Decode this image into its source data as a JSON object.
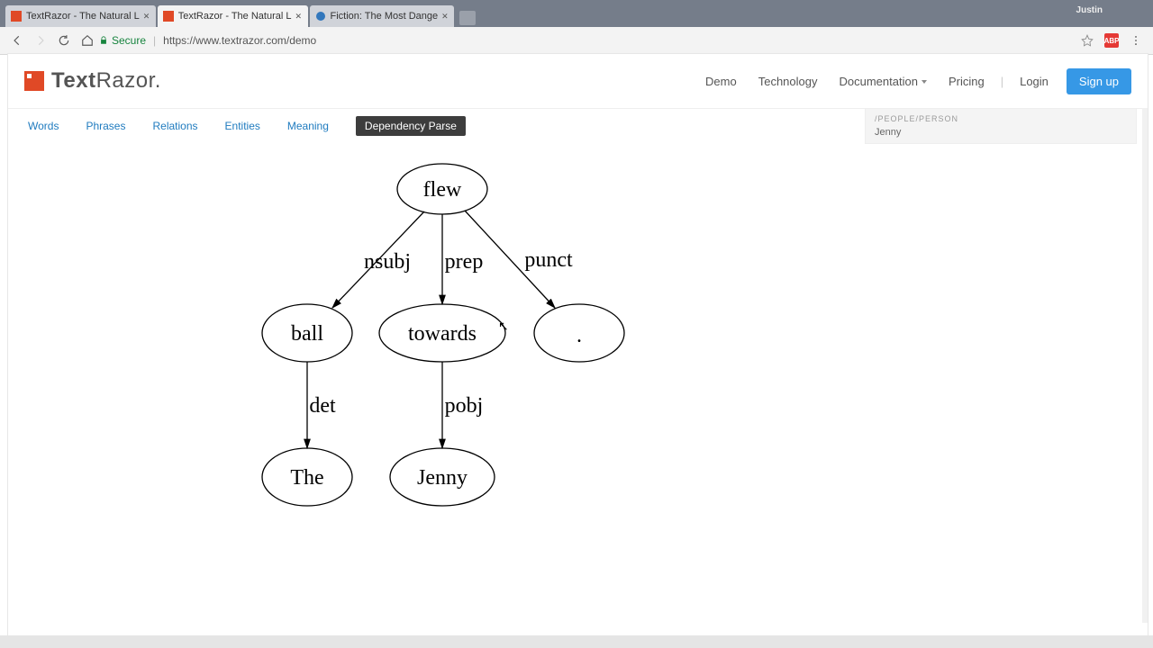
{
  "browser": {
    "user": "Justin",
    "tabs": [
      {
        "title": "TextRazor - The Natural L"
      },
      {
        "title": "TextRazor - The Natural L"
      },
      {
        "title": "Fiction: The Most Dange"
      }
    ],
    "secure_label": "Secure",
    "url": "https://www.textrazor.com/demo",
    "abp": "ABP"
  },
  "site": {
    "brand_bold": "Text",
    "brand_light": "Razor.",
    "nav": {
      "demo": "Demo",
      "technology": "Technology",
      "documentation": "Documentation",
      "pricing": "Pricing",
      "login": "Login",
      "signup": "Sign up"
    }
  },
  "subnav": {
    "words": "Words",
    "phrases": "Phrases",
    "relations": "Relations",
    "entities": "Entities",
    "meaning": "Meaning",
    "dp": "Dependency Parse"
  },
  "panel": {
    "category": "/PEOPLE/PERSON",
    "entity": "Jenny"
  },
  "graph": {
    "nodes": {
      "flew": "flew",
      "ball": "ball",
      "towards": "towards",
      "period": ".",
      "the": "The",
      "jenny": "Jenny"
    },
    "edges": {
      "nsubj": "nsubj",
      "prep": "prep",
      "punct": "punct",
      "det": "det",
      "pobj": "pobj"
    }
  }
}
